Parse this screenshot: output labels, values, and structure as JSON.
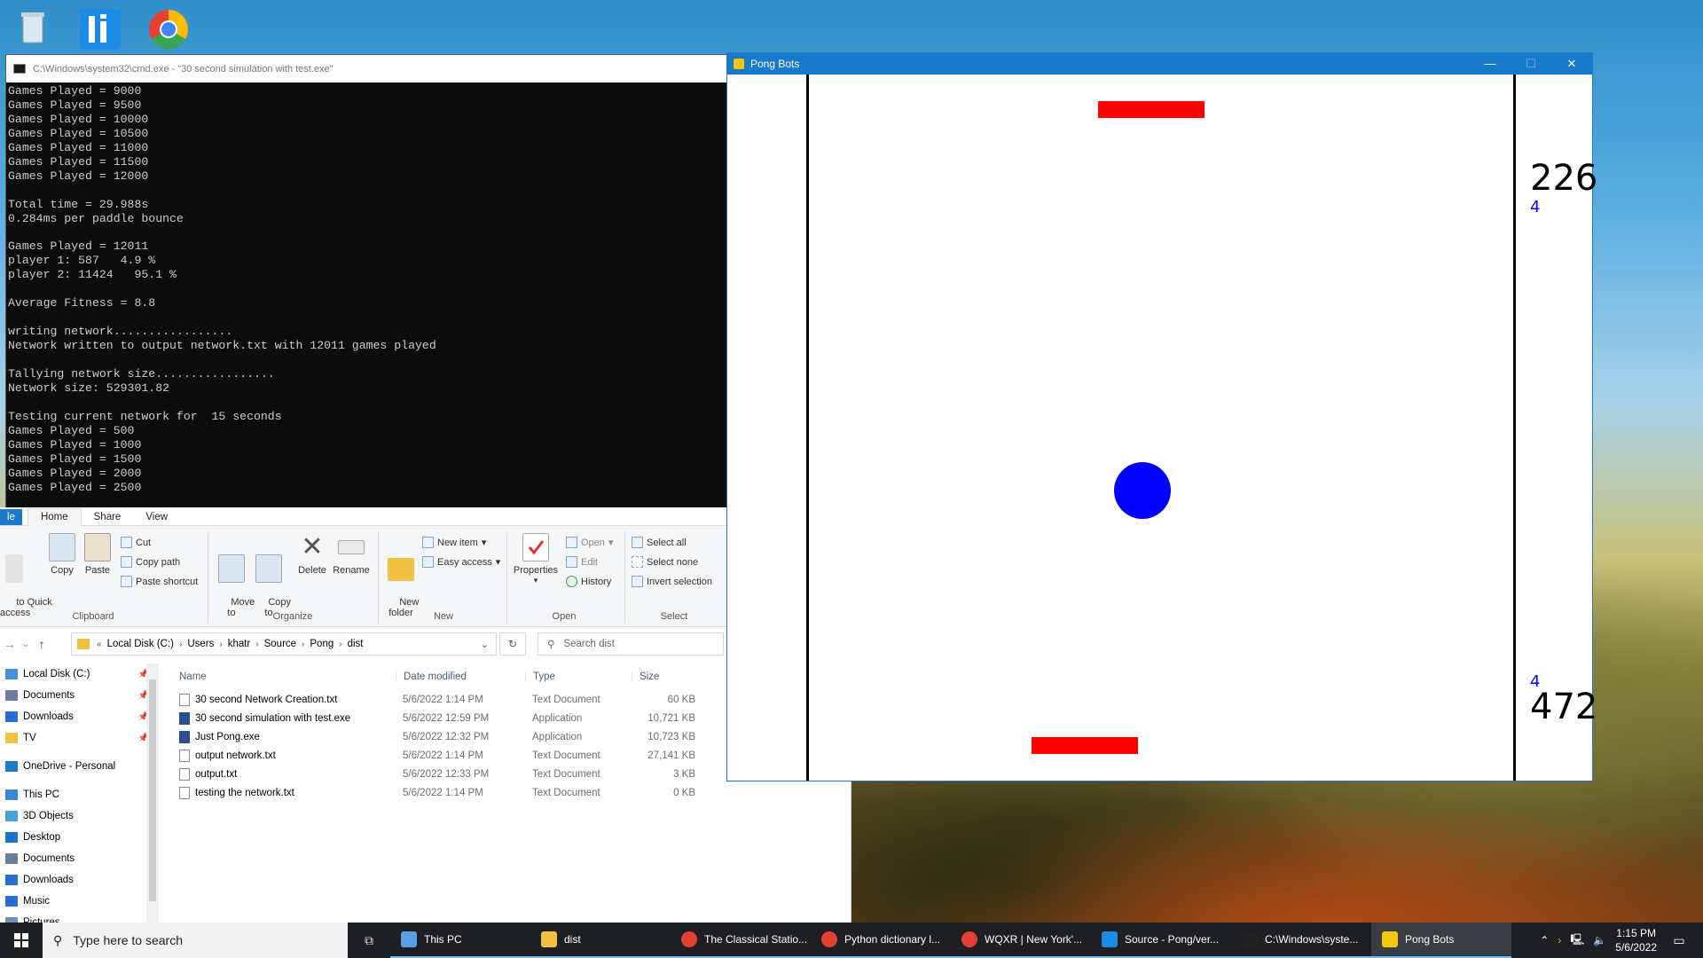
{
  "console": {
    "title": "C:\\Windows\\system32\\cmd.exe - \"30 second simulation with test.exe\"",
    "lines": [
      "Games Played = 9000",
      "Games Played = 9500",
      "Games Played = 10000",
      "Games Played = 10500",
      "Games Played = 11000",
      "Games Played = 11500",
      "Games Played = 12000",
      "",
      "Total time = 29.988s",
      "0.284ms per paddle bounce",
      "",
      "Games Played = 12011",
      "player 1: 587   4.9 %",
      "player 2: 11424   95.1 %",
      "",
      "Average Fitness = 8.8",
      "",
      "writing network.................",
      "Network written to output network.txt with 12011 games played",
      "",
      "Tallying network size.................",
      "Network size: 529301.82",
      "",
      "Testing current network for  15 seconds",
      "Games Played = 500",
      "Games Played = 1000",
      "Games Played = 1500",
      "Games Played = 2000",
      "Games Played = 2500"
    ]
  },
  "explorer": {
    "tabs": [
      "le",
      "Home",
      "Share",
      "View"
    ],
    "ribbon": {
      "clipboard": {
        "quick": "to Quick\naccess",
        "copy": "Copy",
        "paste": "Paste",
        "cut": "Cut",
        "copy_path": "Copy path",
        "paste_shortcut": "Paste shortcut",
        "label": "Clipboard"
      },
      "organize": {
        "move_to": "Move\nto",
        "copy_to": "Copy\nto",
        "delete": "Delete",
        "rename": "Rename",
        "label": "Organize"
      },
      "new": {
        "new_folder": "New\nfolder",
        "new_item": "New item",
        "easy_access": "Easy access",
        "label": "New"
      },
      "open": {
        "properties": "Properties",
        "open": "Open",
        "edit": "Edit",
        "history": "History",
        "label": "Open"
      },
      "select": {
        "select_all": "Select all",
        "select_none": "Select none",
        "invert": "Invert selection",
        "label": "Select"
      }
    },
    "address": [
      "Local Disk (C:)",
      "Users",
      "khatr",
      "Source",
      "Pong",
      "dist"
    ],
    "search_placeholder": "Search dist",
    "nav": [
      {
        "label": "Local Disk (C:)",
        "pin": true,
        "color": "#4a90d9"
      },
      {
        "label": "Documents",
        "pin": true,
        "color": "#6a7f9e"
      },
      {
        "label": "Downloads",
        "pin": true,
        "color": "#2a6fd0"
      },
      {
        "label": "TV",
        "pin": true,
        "color": "#f0c040"
      },
      {
        "label": "OneDrive - Personal",
        "pin": false,
        "color": "#1979ca"
      },
      {
        "label": "This PC",
        "pin": false,
        "color": "#3a86d0"
      },
      {
        "label": "3D Objects",
        "pin": false,
        "color": "#4aa0d9"
      },
      {
        "label": "Desktop",
        "pin": false,
        "color": "#1d73c9"
      },
      {
        "label": "Documents",
        "pin": false,
        "color": "#6a7f9e"
      },
      {
        "label": "Downloads",
        "pin": false,
        "color": "#2a6fd0"
      },
      {
        "label": "Music",
        "pin": false,
        "color": "#2a6fd0"
      },
      {
        "label": "Pictures",
        "pin": false,
        "color": "#6a8fb8"
      }
    ],
    "columns": {
      "name": "Name",
      "date": "Date modified",
      "type": "Type",
      "size": "Size"
    },
    "files": [
      {
        "name": "30 second Network Creation.txt",
        "date": "5/6/2022 1:14 PM",
        "type": "Text Document",
        "size": "60 KB",
        "kind": "txt"
      },
      {
        "name": "30 second simulation with test.exe",
        "date": "5/6/2022 12:59 PM",
        "type": "Application",
        "size": "10,721 KB",
        "kind": "app"
      },
      {
        "name": "Just Pong.exe",
        "date": "5/6/2022 12:32 PM",
        "type": "Application",
        "size": "10,723 KB",
        "kind": "app"
      },
      {
        "name": "output network.txt",
        "date": "5/6/2022 1:14 PM",
        "type": "Text Document",
        "size": "27,141 KB",
        "kind": "txt"
      },
      {
        "name": "output.txt",
        "date": "5/6/2022 12:33 PM",
        "type": "Text Document",
        "size": "3 KB",
        "kind": "txt"
      },
      {
        "name": "testing the network.txt",
        "date": "5/6/2022 1:14 PM",
        "type": "Text Document",
        "size": "0 KB",
        "kind": "txt"
      }
    ]
  },
  "pong": {
    "title": "Pong Bots",
    "top_score": "226",
    "top_small": "4",
    "bottom_small": "4",
    "bottom_score": "472",
    "colors": {
      "paddle": "#ff0000",
      "ball": "#0000ff"
    }
  },
  "taskbar": {
    "search_placeholder": "Type here to search",
    "items": [
      {
        "label": "This PC",
        "icon": "this-pc-icon",
        "color": "#5aa0e0"
      },
      {
        "label": "dist",
        "icon": "folder-icon",
        "color": "#f0c040"
      },
      {
        "label": "The Classical Statio...",
        "icon": "chrome-icon",
        "color": "#e34133"
      },
      {
        "label": "Python dictionary l...",
        "icon": "chrome-icon",
        "color": "#e34133"
      },
      {
        "label": "WQXR | New York'...",
        "icon": "chrome-icon",
        "color": "#e34133"
      },
      {
        "label": "Source - Pong/ver...",
        "icon": "li-icon",
        "color": "#1c8be6"
      },
      {
        "label": "C:\\Windows\\syste...",
        "icon": "cmd-icon",
        "color": "#222222"
      },
      {
        "label": "Pong Bots",
        "icon": "python-icon",
        "color": "#f2c811"
      }
    ],
    "time": "1:15 PM",
    "date": "5/6/2022"
  }
}
